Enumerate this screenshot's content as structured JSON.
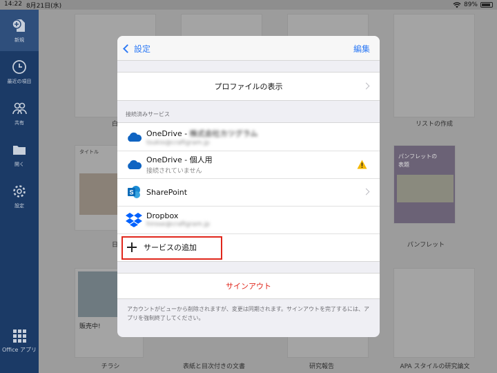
{
  "status_bar": {
    "time": "14:22",
    "date": "8月21日(水)",
    "battery": "89%",
    "battery_level": 0.89
  },
  "sidebar": {
    "items": [
      {
        "label": "新規",
        "icon": "new-document-icon",
        "active": true
      },
      {
        "label": "最近の項目",
        "icon": "clock-icon",
        "active": false
      },
      {
        "label": "共有",
        "icon": "people-icon",
        "active": false
      },
      {
        "label": "開く",
        "icon": "folder-icon",
        "active": false
      },
      {
        "label": "設定",
        "icon": "gear-icon",
        "active": false
      }
    ],
    "office_apps": "Office アプリ"
  },
  "gallery": {
    "labels": [
      "白紙の文",
      "リストの作成",
      "日誌の作",
      "パンフレット",
      "チラシ",
      "表紙と目次付きの文書",
      "研究報告",
      "APA スタイルの研究論文"
    ],
    "thumb_texts": {
      "pamphlet": "パンフレットの\n表題",
      "flyer": "販売中!",
      "diary": "タイトル"
    }
  },
  "modal": {
    "back_label": "設定",
    "edit_label": "編集",
    "profile_label": "プロファイルの表示",
    "section_header": "接続済みサービス",
    "services": [
      {
        "title": "OneDrive - ",
        "title_blurred": "株式会社カツグラム",
        "subtitle": "",
        "subtitle_blurred": "tsukio@craftgram.jp",
        "icon": "onedrive-cloud-icon"
      },
      {
        "title": "OneDrive - 個人用",
        "title_blurred": "",
        "subtitle": "接続されていません",
        "subtitle_blurred": "",
        "icon": "onedrive-cloud-icon",
        "warning": true
      },
      {
        "title": "SharePoint",
        "title_blurred": "",
        "subtitle": "",
        "subtitle_blurred": "",
        "icon": "sharepoint-icon",
        "chevron": true
      },
      {
        "title": "Dropbox",
        "title_blurred": "",
        "subtitle": "",
        "subtitle_blurred": "hirose@craftgram.jp",
        "icon": "dropbox-icon"
      }
    ],
    "add_service_label": "サービスの追加",
    "signout_label": "サインアウト",
    "footnote": "アカウントがビューから削除されますが、変更は同期されます。サインアウトを完了するには、アプリを強制終了してください。"
  },
  "colors": {
    "accent": "#2f7bf5",
    "danger": "#e0261b",
    "onedrive": "#0f64c2",
    "sharepoint": "#0b6bb8",
    "dropbox": "#0061fe",
    "warning": "#f5b800"
  }
}
